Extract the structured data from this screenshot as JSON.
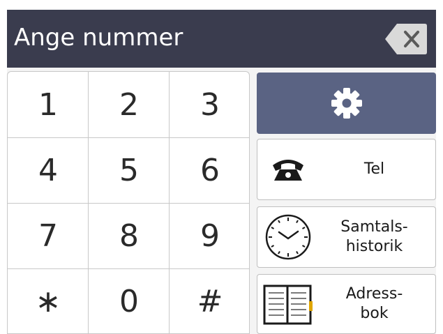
{
  "header": {
    "title": "Ange nummer",
    "backspace_icon": "backspace-x-icon"
  },
  "keypad": {
    "keys": [
      "1",
      "2",
      "3",
      "4",
      "5",
      "6",
      "7",
      "8",
      "9",
      "∗",
      "0",
      "#"
    ]
  },
  "actions": {
    "settings_icon": "gear-icon",
    "tel_label": "Tel",
    "tel_icon": "telephone-icon",
    "history_label": "Samtals-\nhistorik",
    "history_icon": "clock-icon",
    "addressbook_label": "Adress-\nbok",
    "addressbook_icon": "address-book-icon"
  },
  "colors": {
    "header_bg": "#3a3c4e",
    "accent_button": "#5a6383",
    "book_marker": "#e0a600"
  }
}
